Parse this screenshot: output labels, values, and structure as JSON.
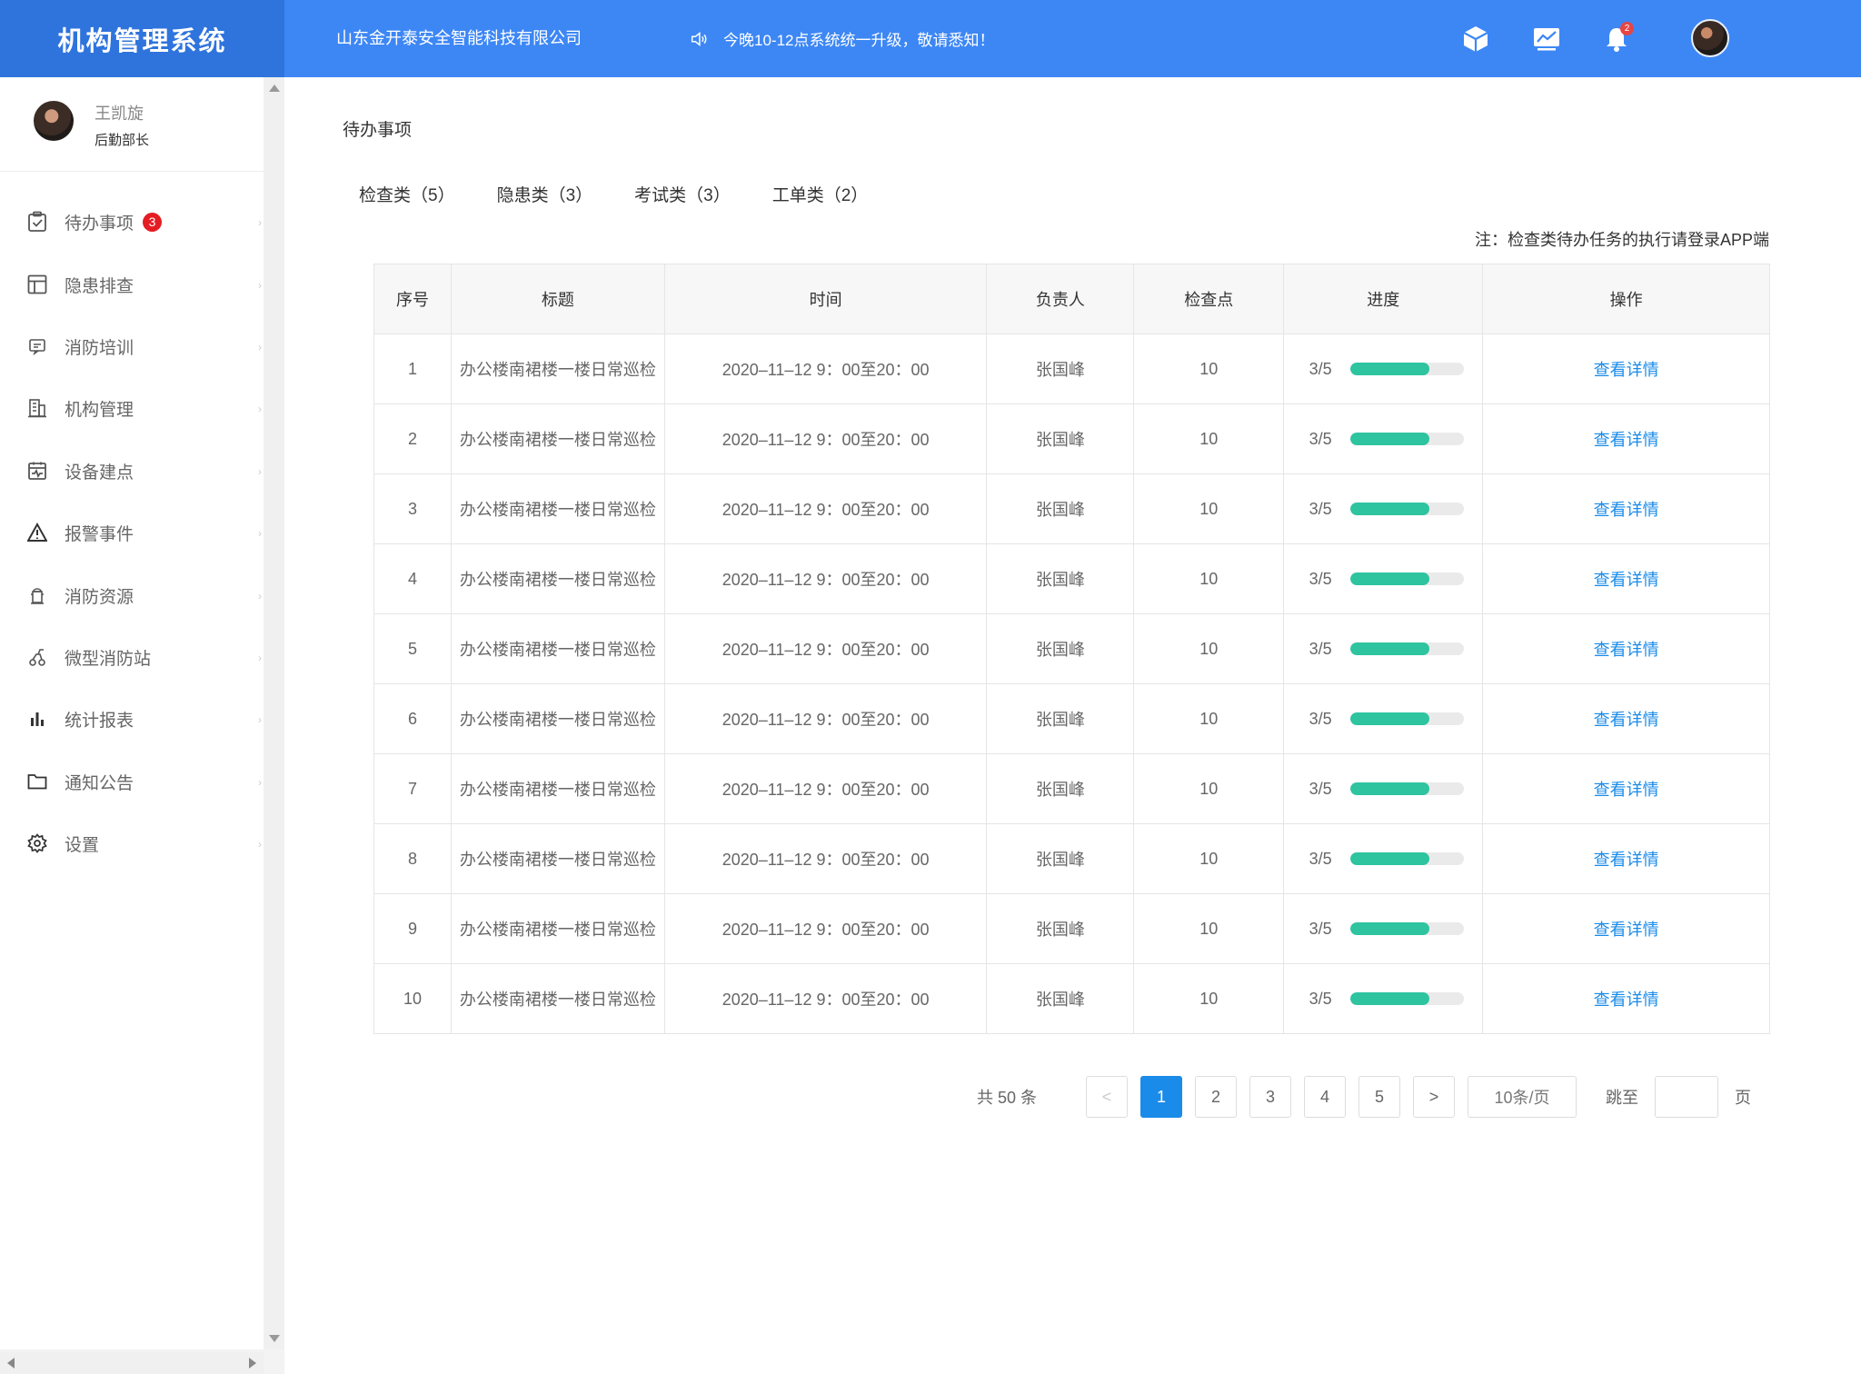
{
  "header": {
    "brand": "机构管理系统",
    "company": "山东金开泰安全智能科技有限公司",
    "notice": "今晚10-12点系统统一升级，敬请悉知！",
    "bell_count": "2",
    "icons": [
      "cube-icon",
      "chart-screen-icon",
      "bell-icon",
      "avatar"
    ],
    "color": "#3d87f5",
    "brand_color": "#2f74dd"
  },
  "user": {
    "name": "王凯旋",
    "role": "后勤部长"
  },
  "sidebar": {
    "items": [
      {
        "label": "待办事项",
        "icon": "clipboard-check-icon",
        "badge": "3"
      },
      {
        "label": "隐患排查",
        "icon": "layout-icon"
      },
      {
        "label": "消防培训",
        "icon": "message-icon"
      },
      {
        "label": "机构管理",
        "icon": "building-icon"
      },
      {
        "label": "设备建点",
        "icon": "calendar-pulse-icon"
      },
      {
        "label": "报警事件",
        "icon": "warning-icon"
      },
      {
        "label": "消防资源",
        "icon": "fire-hydrant-icon"
      },
      {
        "label": "微型消防站",
        "icon": "fire-extinguisher-icon"
      },
      {
        "label": "统计报表",
        "icon": "bar-chart-icon"
      },
      {
        "label": "通知公告",
        "icon": "folder-icon"
      },
      {
        "label": "设置",
        "icon": "gear-icon"
      }
    ]
  },
  "main": {
    "title": "待办事项",
    "tabs": [
      "检查类（5）",
      "隐患类（3）",
      "考试类（3）",
      "工单类（2）"
    ],
    "note": "注：检查类待办任务的执行请登录APP端"
  },
  "table": {
    "columns": [
      "序号",
      "标题",
      "时间",
      "负责人",
      "检查点",
      "进度",
      "操作"
    ],
    "rows": [
      {
        "no": "1",
        "title": "办公楼南裙楼一楼日常巡检",
        "time": "2020–11–12  9：00至20：00",
        "owner": "张国峰",
        "points": "10",
        "progress": "3/5",
        "progress_value": 0.7,
        "action": "查看详情"
      },
      {
        "no": "2",
        "title": "办公楼南裙楼一楼日常巡检",
        "time": "2020–11–12  9：00至20：00",
        "owner": "张国峰",
        "points": "10",
        "progress": "3/5",
        "progress_value": 0.7,
        "action": "查看详情"
      },
      {
        "no": "3",
        "title": "办公楼南裙楼一楼日常巡检",
        "time": "2020–11–12  9：00至20：00",
        "owner": "张国峰",
        "points": "10",
        "progress": "3/5",
        "progress_value": 0.7,
        "action": "查看详情"
      },
      {
        "no": "4",
        "title": "办公楼南裙楼一楼日常巡检",
        "time": "2020–11–12  9：00至20：00",
        "owner": "张国峰",
        "points": "10",
        "progress": "3/5",
        "progress_value": 0.7,
        "action": "查看详情"
      },
      {
        "no": "5",
        "title": "办公楼南裙楼一楼日常巡检",
        "time": "2020–11–12  9：00至20：00",
        "owner": "张国峰",
        "points": "10",
        "progress": "3/5",
        "progress_value": 0.7,
        "action": "查看详情"
      },
      {
        "no": "6",
        "title": "办公楼南裙楼一楼日常巡检",
        "time": "2020–11–12  9：00至20：00",
        "owner": "张国峰",
        "points": "10",
        "progress": "3/5",
        "progress_value": 0.7,
        "action": "查看详情"
      },
      {
        "no": "7",
        "title": "办公楼南裙楼一楼日常巡检",
        "time": "2020–11–12  9：00至20：00",
        "owner": "张国峰",
        "points": "10",
        "progress": "3/5",
        "progress_value": 0.7,
        "action": "查看详情"
      },
      {
        "no": "8",
        "title": "办公楼南裙楼一楼日常巡检",
        "time": "2020–11–12  9：00至20：00",
        "owner": "张国峰",
        "points": "10",
        "progress": "3/5",
        "progress_value": 0.7,
        "action": "查看详情"
      },
      {
        "no": "9",
        "title": "办公楼南裙楼一楼日常巡检",
        "time": "2020–11–12  9：00至20：00",
        "owner": "张国峰",
        "points": "10",
        "progress": "3/5",
        "progress_value": 0.7,
        "action": "查看详情"
      },
      {
        "no": "10",
        "title": "办公楼南裙楼一楼日常巡检",
        "time": "2020–11–12  9：00至20：00",
        "owner": "张国峰",
        "points": "10",
        "progress": "3/5",
        "progress_value": 0.7,
        "action": "查看详情"
      }
    ],
    "progress_color": "#2ec4a0",
    "link_color": "#1a8be8"
  },
  "pagination": {
    "total": "共 50 条",
    "prev": "<",
    "pages": [
      "1",
      "2",
      "3",
      "4",
      "5"
    ],
    "current": "1",
    "next": ">",
    "page_size": "10条/页",
    "jump_label": "跳至",
    "jump_value": "",
    "page_suffix": "页"
  }
}
